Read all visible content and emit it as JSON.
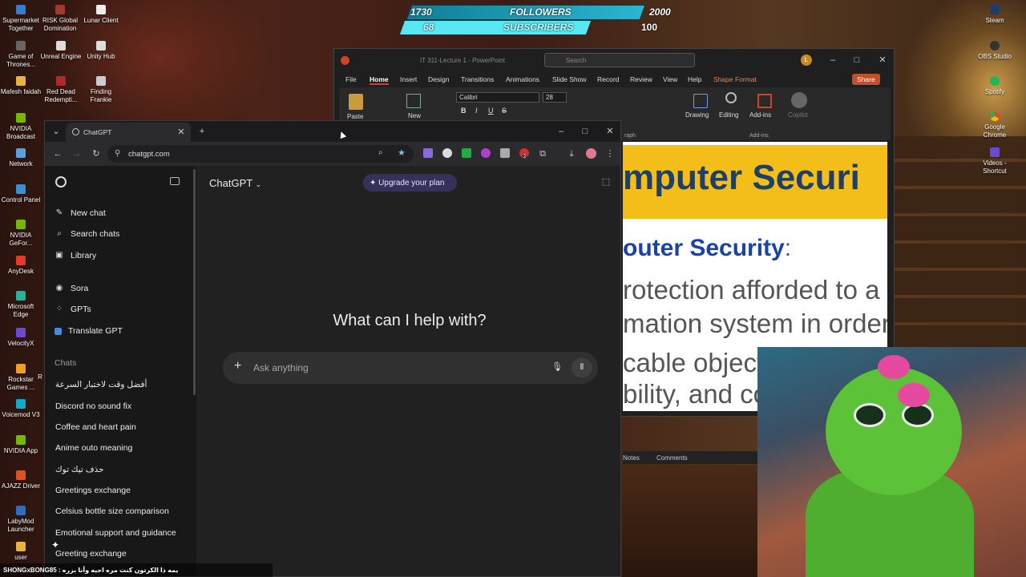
{
  "desktop": {
    "icons": [
      {
        "label": "Supermarket Together",
        "icon": "app-icon"
      },
      {
        "label": "RISK Global Domination",
        "icon": "app-icon"
      },
      {
        "label": "Lunar Client",
        "icon": "app-icon"
      },
      {
        "label": "Game of Thrones...",
        "icon": "app-icon"
      },
      {
        "label": "Unreal Engine",
        "icon": "app-icon"
      },
      {
        "label": "Unity Hub",
        "icon": "app-icon"
      },
      {
        "label": "Mafesh faidah",
        "icon": "folder-icon"
      },
      {
        "label": "Red Dead Redempti...",
        "icon": "app-icon"
      },
      {
        "label": "Finding Frankie",
        "icon": "app-icon"
      },
      {
        "label": "NVIDIA Broadcast",
        "icon": "app-icon"
      },
      {
        "label": "Network",
        "icon": "network-icon"
      },
      {
        "label": "Control Panel",
        "icon": "control-panel-icon"
      },
      {
        "label": "NVIDIA GeFor...",
        "icon": "app-icon"
      },
      {
        "label": "AnyDesk",
        "icon": "app-icon"
      },
      {
        "label": "Microsoft Edge",
        "icon": "edge-icon"
      },
      {
        "label": "VelocityX",
        "icon": "app-icon"
      },
      {
        "label": "Rockstar Games ...",
        "icon": "app-icon"
      },
      {
        "label": "R",
        "icon": "app-icon"
      },
      {
        "label": "Voicemod V3",
        "icon": "app-icon"
      },
      {
        "label": "NVIDIA App",
        "icon": "app-icon"
      },
      {
        "label": "AJAZZ Driver",
        "icon": "app-icon"
      },
      {
        "label": "LabyMod Launcher",
        "icon": "app-icon"
      },
      {
        "label": "user",
        "icon": "folder-icon"
      },
      {
        "label": "Steam",
        "icon": "steam-icon"
      },
      {
        "label": "OBS Studio",
        "icon": "obs-icon"
      },
      {
        "label": "Spotify",
        "icon": "spotify-icon"
      },
      {
        "label": "Google Chrome",
        "icon": "chrome-icon"
      },
      {
        "label": "Videos - Shortcut",
        "icon": "video-icon"
      }
    ]
  },
  "stream_overlay": {
    "followers_current": "1730",
    "followers_label": "FOLLOWERS",
    "followers_goal": "2000",
    "subs_current": "68",
    "subs_label": "SUBSCRIBERS",
    "subs_goal": "100",
    "chat_message": "SHONGxBONG85 : يمه ذا الكرتون كنت مره احبه وأنا بزره"
  },
  "powerpoint": {
    "file_title": "IT 311-Lecture 1  -  PowerPoint",
    "search_placeholder": "Search",
    "avatar": "L",
    "menu": [
      "File",
      "Home",
      "Insert",
      "Design",
      "Transitions",
      "Animations",
      "Slide Show",
      "Record",
      "Review",
      "View",
      "Help",
      "Shape Format"
    ],
    "share_label": "Share",
    "ribbon": {
      "paste": "Paste",
      "new": "New",
      "font": "Calibri",
      "size": "28",
      "bold": "B",
      "italic": "I",
      "underline": "U",
      "strike": "S",
      "drawing": "Drawing",
      "editing": "Editing",
      "addins": "Add-ins",
      "copilot": "Copilot",
      "group_addins": "Add-ins",
      "group_paragraph": "raph"
    },
    "slide": {
      "title": "mputer Securi",
      "subtitle": "outer Security",
      "subtitle_colon": ":",
      "line1": "rotection afforded to a",
      "line2": "mation system in order",
      "line3": "cable object",
      "line4": "bility, and co"
    },
    "status": {
      "notes": "Notes",
      "comments": "Comments"
    }
  },
  "browser": {
    "tab_title": "ChatGPT",
    "url": "chatgpt.com",
    "extension_badge": "2"
  },
  "chatgpt": {
    "sidebar": {
      "new_chat": "New chat",
      "search_chats": "Search chats",
      "library": "Library",
      "sora": "Sora",
      "gpts": "GPTs",
      "translate_gpt": "Translate GPT",
      "chats_header": "Chats",
      "history": [
        "أفضل وقت لاختبار السرعة",
        "Discord no sound fix",
        "Coffee and heart pain",
        "Anime outo meaning",
        "حذف تيك توك",
        "Greetings exchange",
        "Celsius bottle size comparison",
        "Emotional support and guidance",
        "Greeting exchange"
      ]
    },
    "model_label": "ChatGPT",
    "upgrade_label": "Upgrade your plan",
    "hero": "What can I help with?",
    "composer_placeholder": "Ask anything"
  }
}
